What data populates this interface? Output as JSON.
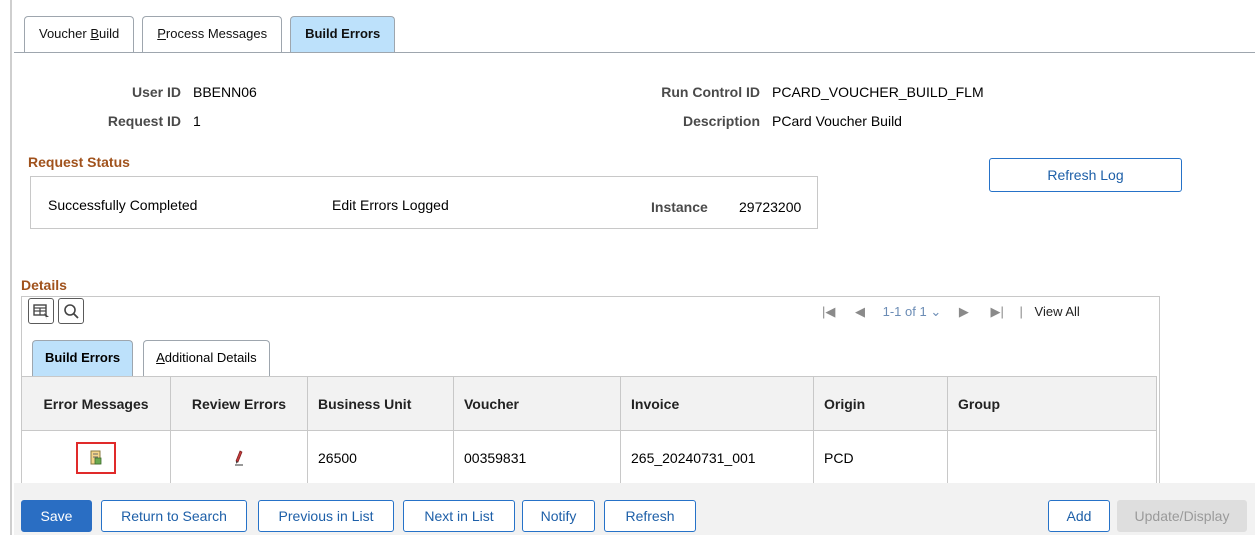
{
  "tabs": [
    {
      "label": "Voucher Build",
      "accel": "B"
    },
    {
      "label": "Process Messages",
      "accel": "P"
    },
    {
      "label": "Build Errors"
    }
  ],
  "header": {
    "user_id_label": "User ID",
    "user_id": "BBENN06",
    "request_id_label": "Request ID",
    "request_id": "1",
    "run_control_label": "Run Control ID",
    "run_control": "PCARD_VOUCHER_BUILD_FLM",
    "description_label": "Description",
    "description": "PCard Voucher Build"
  },
  "request_status": {
    "title": "Request Status",
    "status": "Successfully Completed",
    "edit": "Edit Errors Logged",
    "instance_label": "Instance",
    "instance": "29723200",
    "refresh_log": "Refresh Log"
  },
  "details": {
    "title": "Details",
    "pager": {
      "range": "1-1 of 1",
      "view_all": "View All"
    },
    "subtabs": [
      {
        "label": "Build Errors"
      },
      {
        "label": "Additional Details",
        "accel": "A"
      }
    ],
    "columns": [
      "Error Messages",
      "Review Errors",
      "Business Unit",
      "Voucher",
      "Invoice",
      "Origin",
      "Group"
    ],
    "rows": [
      {
        "business_unit": "26500",
        "voucher": "00359831",
        "invoice": "265_20240731_001",
        "origin": "PCD",
        "group": ""
      }
    ]
  },
  "toolbar": {
    "save": "Save",
    "return": "Return to Search",
    "previous": "Previous in List",
    "next": "Next in List",
    "notify": "Notify",
    "refresh": "Refresh",
    "add": "Add",
    "update": "Update/Display"
  },
  "colors": {
    "accent": "#2a6ec3",
    "tab_active": "#bde1fb",
    "section_title": "#a0521c",
    "highlight": "#e02a2a"
  }
}
